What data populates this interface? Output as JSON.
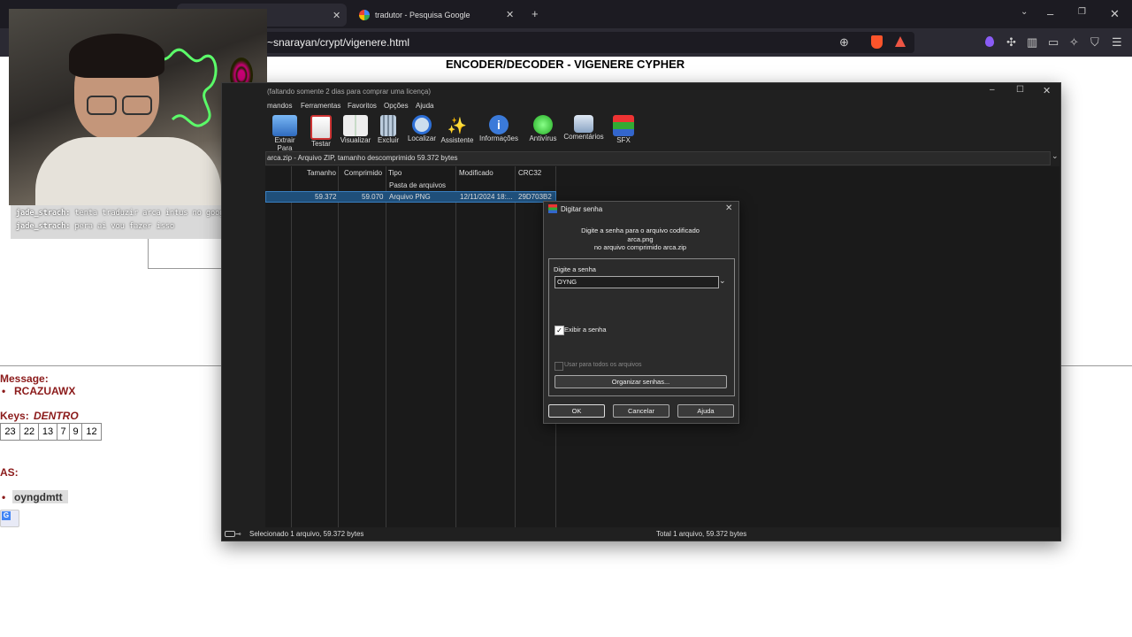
{
  "browser": {
    "tab1_title": "",
    "tab2_title": "tradutor - Pesquisa Google",
    "url": "~snarayan/crypt/vigenere.html"
  },
  "page": {
    "title": "ENCODER/DECODER - VIGENERE CYPHER",
    "message_label": "Message:",
    "message_value": "RCAZUAWX",
    "keys_label": "Keys:",
    "keys_word": "DENTRO",
    "keys": [
      "23",
      "22",
      "13",
      "7",
      "9",
      "12"
    ],
    "as_label": "AS:",
    "as_value": "oyngdmtt"
  },
  "chat": {
    "line1_user": "jade_strach:",
    "line1_text": "tenta traduzir arca intus no google _",
    "line2_user": "jade_strach:",
    "line2_text": "pera ai vou fazer isso"
  },
  "winrar": {
    "title": "(faltando somente 2 dias para comprar uma licença)",
    "menu": [
      "mandos",
      "Ferramentas",
      "Favoritos",
      "Opções",
      "Ajuda"
    ],
    "toolbar": [
      "Extrair Para",
      "Testar",
      "Visualizar",
      "Excluir",
      "Localizar",
      "Assistente",
      "Informações",
      "Antivírus",
      "Comentários",
      "SFX"
    ],
    "path": "arca.zip - Arquivo ZIP, tamanho descomprimido 59.372 bytes",
    "columns": [
      "Tamanho",
      "Comprimido",
      "Tipo",
      "Modificado",
      "CRC32"
    ],
    "folder_row": "Pasta de arquivos",
    "file_row": {
      "tamanho": "59.372",
      "comprimido": "59.070",
      "tipo": "Arquivo PNG",
      "modificado": "12/11/2024 18:...",
      "crc": "29D703B2"
    },
    "status_left": "Selecionado 1 arquivo, 59.372 bytes",
    "status_right": "Total 1 arquivo, 59.372 bytes"
  },
  "dialog": {
    "title": "Digitar senha",
    "line1": "Digite a senha para o arquivo codificado",
    "line2": "arca.png",
    "line3": "no arquivo comprimido arca.zip",
    "group_label": "Digite a senha",
    "password": "OYNG",
    "show_password": "Exibir a senha",
    "use_all": "Usar para todos os arquivos",
    "organize": "Organizar senhas...",
    "ok": "OK",
    "cancel": "Cancelar",
    "help": "Ajuda"
  }
}
